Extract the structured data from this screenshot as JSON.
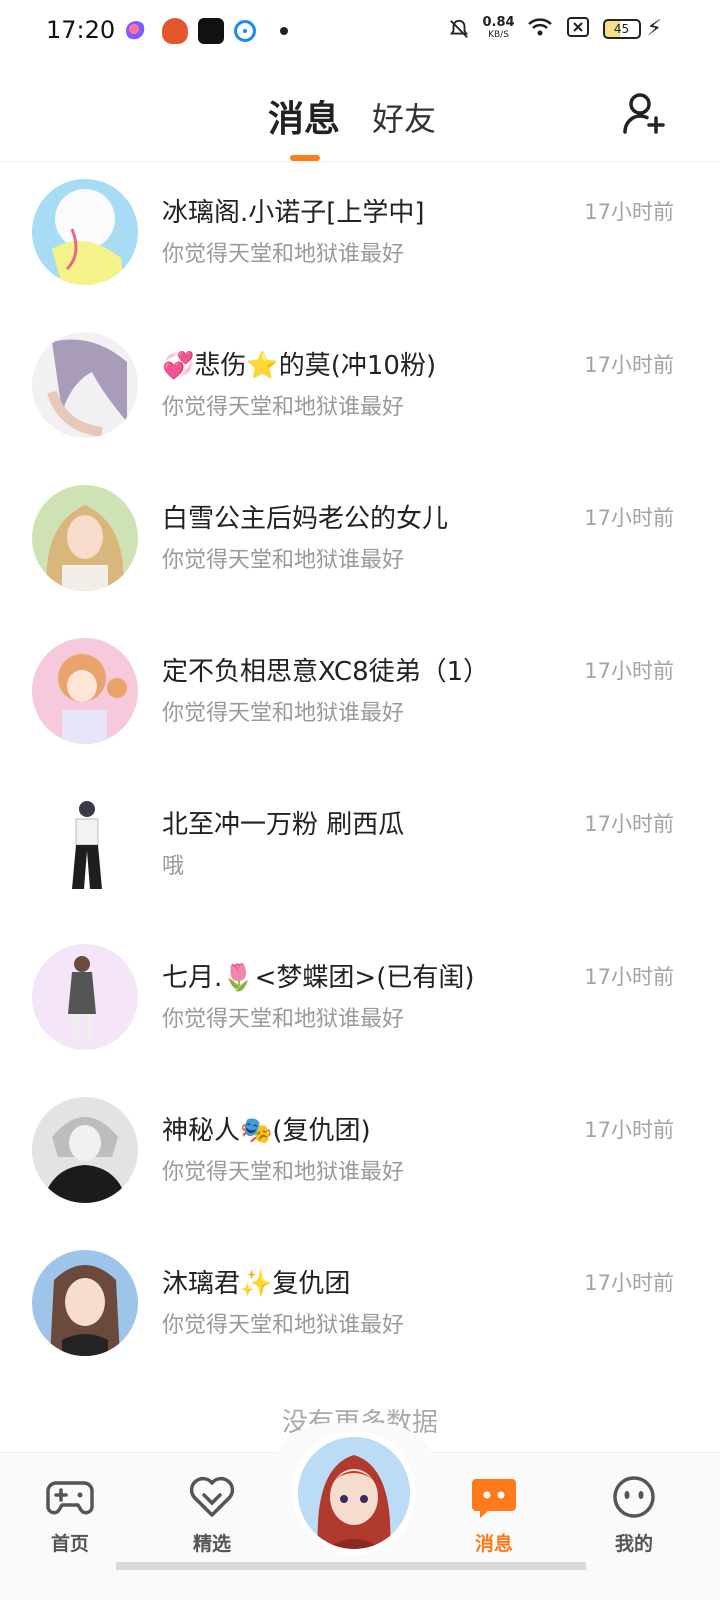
{
  "status_bar": {
    "time": "17:20",
    "net_speed_value": "0.84",
    "net_speed_unit": "KB/S",
    "battery": "45"
  },
  "header": {
    "tab_messages": "消息",
    "tab_friends": "好友",
    "add_friend_icon": "add-person-icon"
  },
  "messages": [
    {
      "name": "冰璃阁.小诺子[上学中]",
      "preview": "你觉得天堂和地狱谁最好",
      "time": "17小时前"
    },
    {
      "name": "💞悲伤⭐的莫(冲10粉)",
      "preview": "你觉得天堂和地狱谁最好",
      "time": "17小时前"
    },
    {
      "name": "白雪公主后妈老公的女儿",
      "preview": "你觉得天堂和地狱谁最好",
      "time": "17小时前"
    },
    {
      "name": "定不负相思意XC8徒弟（1）",
      "preview": "你觉得天堂和地狱谁最好",
      "time": "17小时前"
    },
    {
      "name": "北至冲一万粉 刷西瓜",
      "preview": "哦",
      "time": "17小时前"
    },
    {
      "name": "七月.🌷<梦蝶团>(已有闺)",
      "preview": "你觉得天堂和地狱谁最好",
      "time": "17小时前"
    },
    {
      "name": "神秘人🎭(复仇团)",
      "preview": "你觉得天堂和地狱谁最好",
      "time": "17小时前"
    },
    {
      "name": "沐璃君✨复仇团",
      "preview": "你觉得天堂和地狱谁最好",
      "time": "17小时前"
    }
  ],
  "list_footer": "没有更多数据",
  "bottom_nav": [
    {
      "label": "首页",
      "icon": "gamepad-icon"
    },
    {
      "label": "精选",
      "icon": "heart-icon"
    },
    {
      "label": "消息",
      "icon": "chat-icon",
      "active": true
    },
    {
      "label": "我的",
      "icon": "face-icon"
    }
  ],
  "colors": {
    "accent": "#ff7a1a",
    "muted_text": "#9a9a9a"
  }
}
